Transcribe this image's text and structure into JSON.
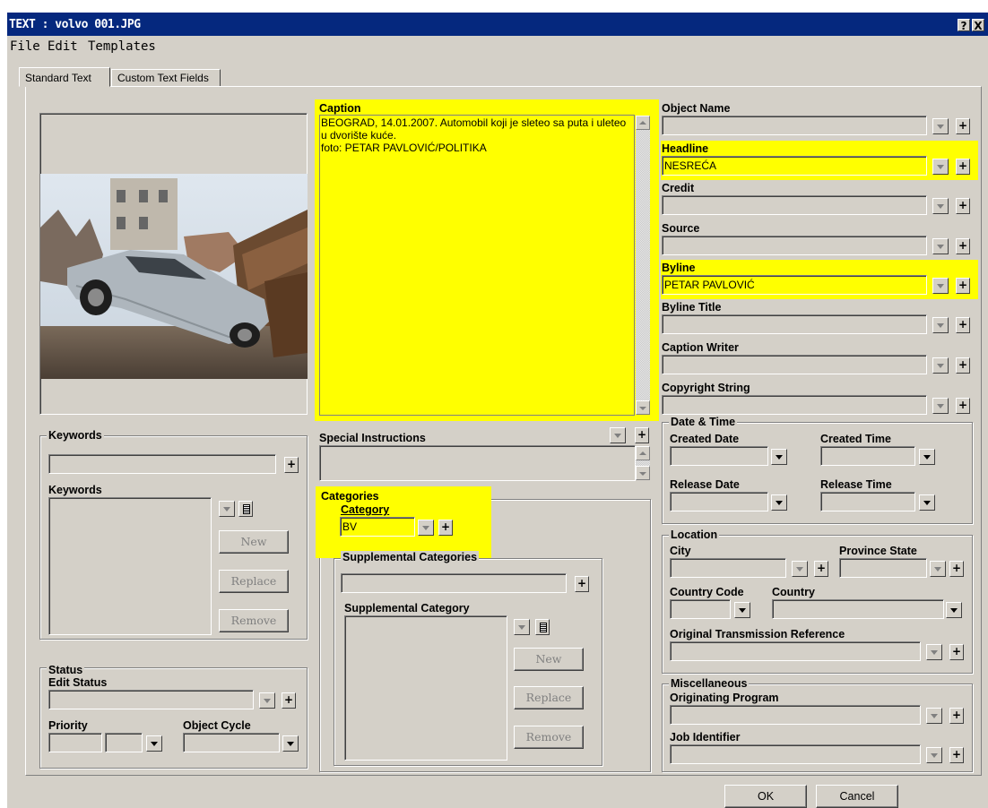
{
  "window": {
    "title": "TEXT : volvo 001.JPG",
    "help_label": "?",
    "close_label": "X"
  },
  "menu": [
    "File",
    "Edit",
    "Templates"
  ],
  "tabs": [
    "Standard Text",
    "Custom Text Fields"
  ],
  "caption": {
    "label": "Caption",
    "text": "BEOGRAD, 14.01.2007. Automobil koji je sleteo sa puta i uleteo u dvorište kuće.\nfoto: PETAR PAVLOVIĆ/POLITIKA"
  },
  "right_fields": {
    "object_name": {
      "label": "Object Name",
      "value": ""
    },
    "headline": {
      "label": "Headline",
      "value": "NESREĆA"
    },
    "credit": {
      "label": "Credit",
      "value": ""
    },
    "source": {
      "label": "Source",
      "value": ""
    },
    "byline": {
      "label": "Byline",
      "value": "PETAR PAVLOVIĆ"
    },
    "byline_title": {
      "label": "Byline Title",
      "value": ""
    },
    "caption_writer": {
      "label": "Caption Writer",
      "value": ""
    },
    "copyright": {
      "label": "Copyright String",
      "value": ""
    }
  },
  "plus_label": "+",
  "date_time": {
    "group": "Date & Time",
    "created_date": "Created Date",
    "created_time": "Created Time",
    "release_date": "Release Date",
    "release_time": "Release Time"
  },
  "location": {
    "group": "Location",
    "city": "City",
    "province": "Province State",
    "country_code": "Country Code",
    "country": "Country",
    "otr": "Original Transmission Reference"
  },
  "misc": {
    "group": "Miscellaneous",
    "program": "Originating Program",
    "job": "Job Identifier"
  },
  "special_instructions": {
    "label": "Special Instructions",
    "value": ""
  },
  "categories": {
    "group": "Categories",
    "category_label": "Category",
    "category_value": "BV",
    "supp_group": "Supplemental Categories",
    "supp_label": "Supplemental Category",
    "new": "New",
    "replace": "Replace",
    "remove": "Remove"
  },
  "keywords": {
    "group": "Keywords",
    "list_label": "Keywords",
    "new": "New",
    "replace": "Replace",
    "remove": "Remove"
  },
  "status": {
    "group": "Status",
    "edit_status": "Edit Status",
    "priority": "Priority",
    "object_cycle": "Object Cycle"
  },
  "footer": {
    "ok": "OK",
    "cancel": "Cancel"
  },
  "colors": {
    "title_bar": "#05287e",
    "highlight": "#ffff00",
    "face": "#d4d0c8"
  }
}
